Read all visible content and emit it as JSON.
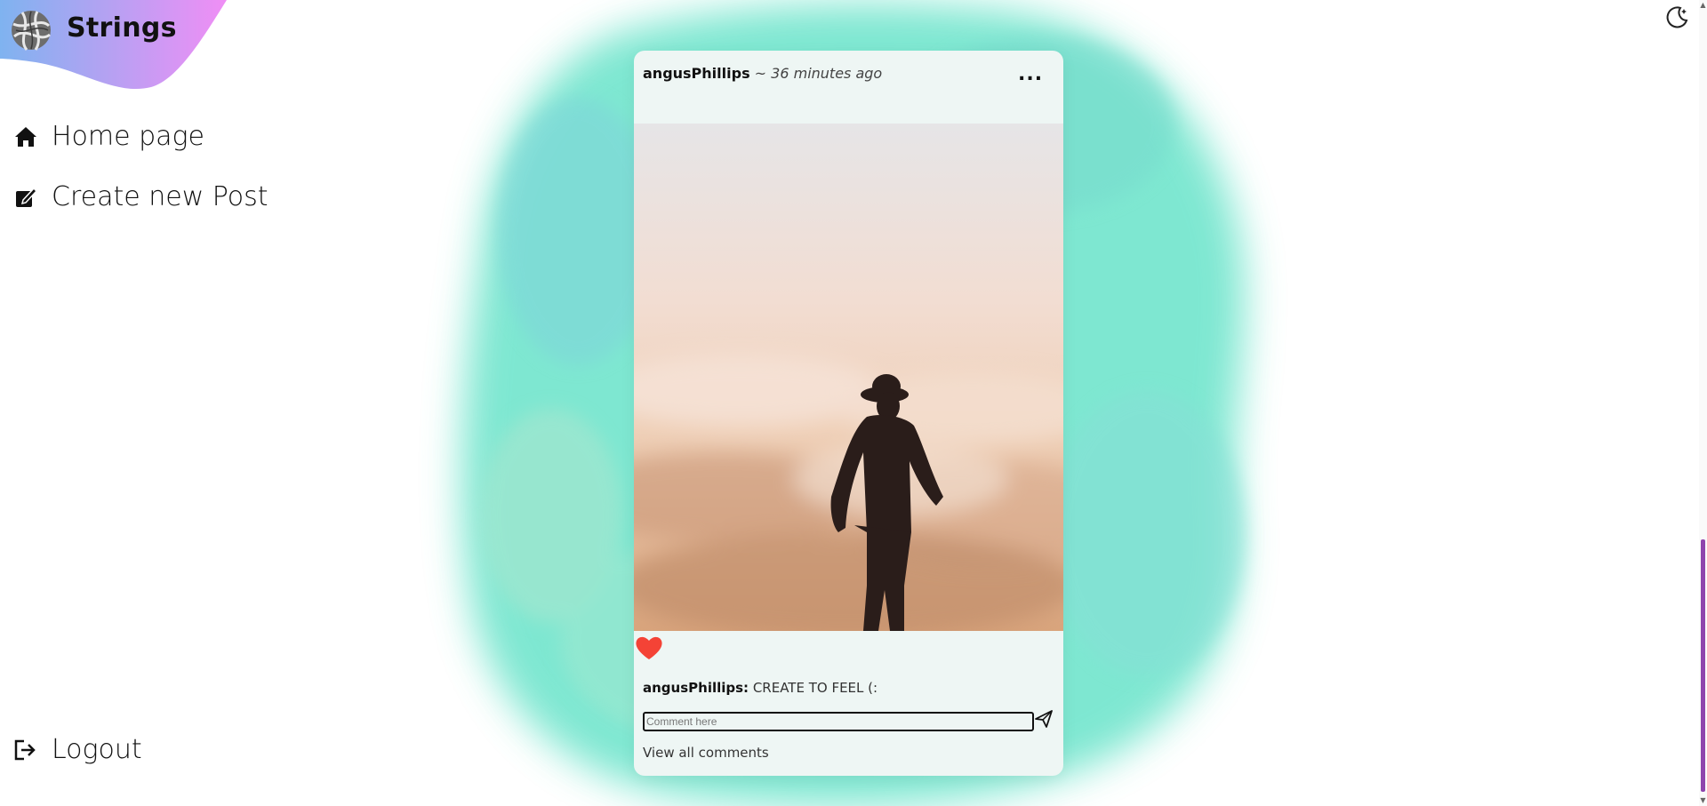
{
  "app": {
    "brand": "Strings"
  },
  "nav": {
    "home": "Home page",
    "create": "Create new Post",
    "logout": "Logout"
  },
  "post": {
    "username": "angusPhillips",
    "separator": " ~ ",
    "time_ago": "36 minutes ago",
    "more_label": "...",
    "caption_user": "angusPhillips:",
    "caption_text": " CREATE TO FEEL (:",
    "comment_placeholder": "Comment here",
    "view_all": "View all comments"
  },
  "icons": {
    "logo": "yarn-ball-icon",
    "home": "home-icon",
    "create": "edit-icon",
    "logout": "logout-icon",
    "theme": "moon-icon",
    "like": "heart-icon",
    "send": "send-icon",
    "more": "ellipsis-icon"
  },
  "colors": {
    "accent_gradient_start": "#f08ef5",
    "accent_gradient_end": "#7fb3f0",
    "like": "#f44336",
    "scroll_thumb": "#8e44ad",
    "splash": "#5fe0c6"
  }
}
